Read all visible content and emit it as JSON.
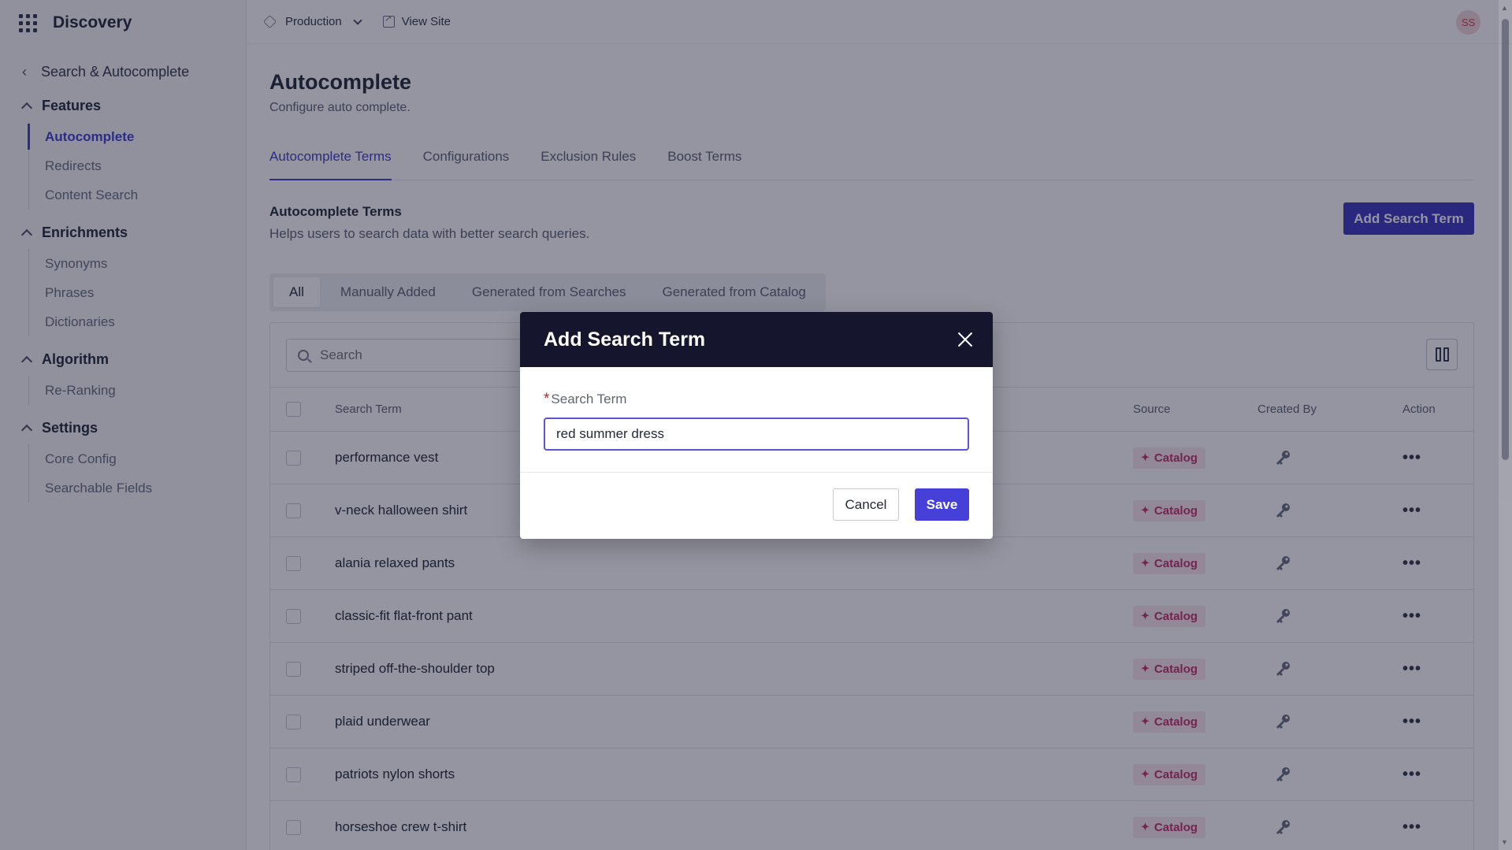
{
  "app": {
    "name": "Discovery"
  },
  "topbar": {
    "environment": "Production",
    "view_site": "View Site",
    "avatar_initials": "SS"
  },
  "sidebar": {
    "back_label": "Search & Autocomplete",
    "groups": [
      {
        "label": "Features",
        "items": [
          "Autocomplete",
          "Redirects",
          "Content Search"
        ]
      },
      {
        "label": "Enrichments",
        "items": [
          "Synonyms",
          "Phrases",
          "Dictionaries"
        ]
      },
      {
        "label": "Algorithm",
        "items": [
          "Re-Ranking"
        ]
      },
      {
        "label": "Settings",
        "items": [
          "Core Config",
          "Searchable Fields"
        ]
      }
    ],
    "active_item": "Autocomplete"
  },
  "page": {
    "title": "Autocomplete",
    "subtitle": "Configure auto complete.",
    "tabs": [
      "Autocomplete Terms",
      "Configurations",
      "Exclusion Rules",
      "Boost Terms"
    ],
    "active_tab": "Autocomplete Terms"
  },
  "section": {
    "title": "Autocomplete Terms",
    "subtitle": "Helps users to search data with better search queries.",
    "add_button": "Add Search Term",
    "filters": [
      "All",
      "Manually Added",
      "Generated from Searches",
      "Generated from Catalog"
    ],
    "active_filter": "All"
  },
  "table": {
    "search_placeholder": "Search",
    "columns": {
      "term": "Search Term",
      "source": "Source",
      "created_by": "Created By",
      "action": "Action"
    },
    "rows": [
      {
        "term": "performance vest",
        "source": "Catalog"
      },
      {
        "term": "v-neck halloween shirt",
        "source": "Catalog"
      },
      {
        "term": "alania relaxed pants",
        "source": "Catalog"
      },
      {
        "term": "classic-fit flat-front pant",
        "source": "Catalog"
      },
      {
        "term": "striped off-the-shoulder top",
        "source": "Catalog"
      },
      {
        "term": "plaid underwear",
        "source": "Catalog"
      },
      {
        "term": "patriots nylon shorts",
        "source": "Catalog"
      },
      {
        "term": "horseshoe crew t-shirt",
        "source": "Catalog"
      }
    ],
    "action_glyph": "•••"
  },
  "modal": {
    "title": "Add Search Term",
    "field_label": "Search Term",
    "required_mark": "*",
    "field_value": "red summer dress",
    "cancel_label": "Cancel",
    "save_label": "Save"
  },
  "colors": {
    "accent": "#4640c9",
    "modal_header": "#15162e",
    "badge_text": "#c3326d",
    "badge_bg": "#fbe7ef"
  }
}
